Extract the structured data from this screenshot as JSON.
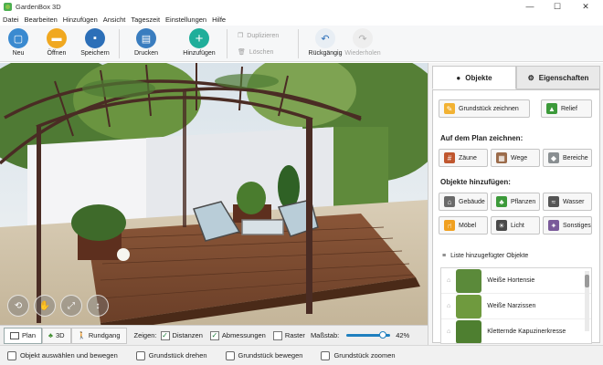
{
  "window": {
    "title": "GardenBox 3D",
    "minimize": "—",
    "maximize": "☐",
    "close": "✕"
  },
  "menu": [
    "Datei",
    "Bearbeiten",
    "Hinzufügen",
    "Ansicht",
    "Tageszeit",
    "Einstellungen",
    "Hilfe"
  ],
  "toolbar": {
    "new": "Neu",
    "open": "Öffnen",
    "save": "Speichern",
    "print": "Drucken",
    "add": "Hinzufügen",
    "duplicate": "Duplizieren",
    "delete": "Löschen",
    "undo": "Rückgängig",
    "redo": "Wiederholen"
  },
  "viewbar": {
    "plan": "Plan",
    "threed": "3D",
    "walk": "Rundgang",
    "show": "Zeigen:",
    "distances": "Distanzen",
    "dimensions": "Abmessungen",
    "grid": "Raster",
    "scale": "Maßstab:",
    "scale_value": "42%",
    "scale_fraction": 0.42,
    "distances_checked": true,
    "dimensions_checked": true,
    "grid_checked": false
  },
  "status": {
    "select": "Objekt auswählen und bewegen",
    "rotate": "Grundstück drehen",
    "move": "Grundstück bewegen",
    "zoom": "Grundstück zoomen"
  },
  "panel": {
    "tab_objects": "Objekte",
    "tab_properties": "Eigenschaften",
    "draw_plot": "Grundstück zeichnen",
    "relief": "Relief",
    "draw_on_plan": "Auf dem Plan zeichnen:",
    "fences": "Zäune",
    "paths": "Wege",
    "areas": "Bereiche",
    "add_objects": "Objekte hinzufügen:",
    "buildings": "Gebäude",
    "plants": "Pflanzen",
    "water": "Wasser",
    "furniture": "Möbel",
    "light": "Licht",
    "other": "Sonstiges",
    "list_title": "Liste hinzugefügter Objekte",
    "list": [
      {
        "name": "Weiße Hortensie"
      },
      {
        "name": "Weiße Narzissen"
      },
      {
        "name": "Kletternde Kapuzinerkresse"
      }
    ]
  },
  "colors": {
    "accent": "#1f7fbf",
    "add_button": "#1fae9a",
    "deck": "#7a4a33"
  }
}
